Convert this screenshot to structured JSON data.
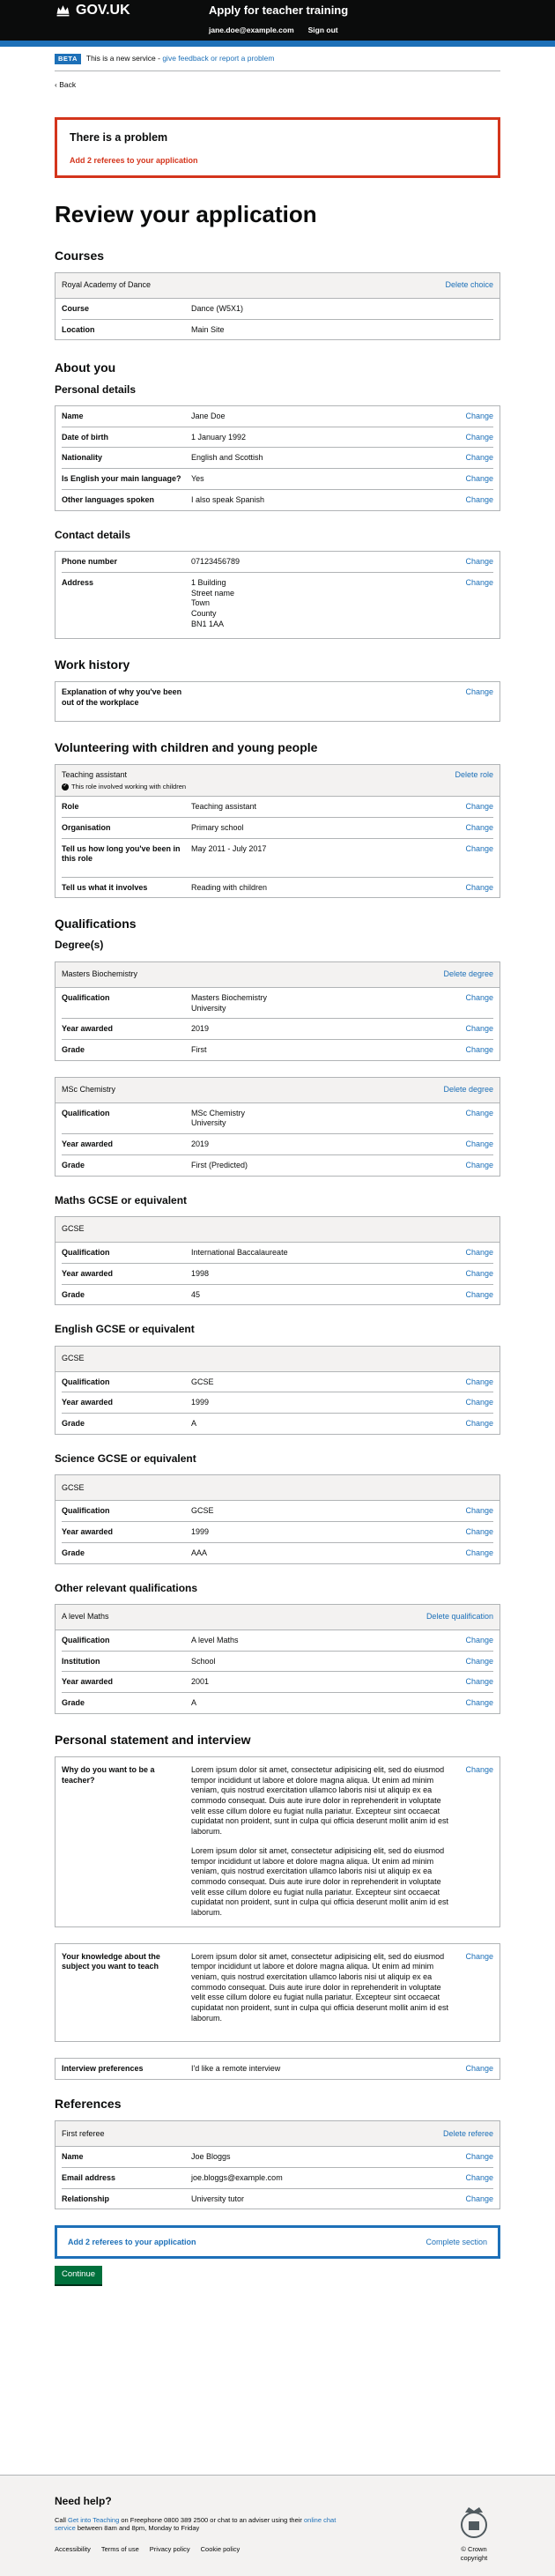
{
  "header": {
    "logo": "GOV.UK",
    "service": "Apply for teacher training",
    "email": "jane.doe@example.com",
    "signout": "Sign out"
  },
  "beta": {
    "tag": "BETA",
    "text": "This is a new service - ",
    "link": "give feedback or report a problem"
  },
  "back": "Back",
  "error": {
    "title": "There is a problem",
    "link": "Add 2 referees to your application"
  },
  "title": "Review your application",
  "courses": {
    "heading": "Courses",
    "card_title": "Royal Academy of Dance",
    "action": "Delete choice",
    "rows": [
      {
        "k": "Course",
        "v": "Dance (W5X1)"
      },
      {
        "k": "Location",
        "v": "Main Site"
      }
    ]
  },
  "about": "About you",
  "personal": {
    "heading": "Personal details",
    "rows": [
      {
        "k": "Name",
        "v": "Jane Doe"
      },
      {
        "k": "Date of birth",
        "v": "1 January 1992"
      },
      {
        "k": "Nationality",
        "v": "English and Scottish"
      },
      {
        "k": "Is English your main language?",
        "v": "Yes"
      },
      {
        "k": "Other languages spoken",
        "v": "I also speak Spanish"
      }
    ]
  },
  "change": "Change",
  "contact": {
    "heading": "Contact details",
    "phone_k": "Phone number",
    "phone_v": "07123456789",
    "addr_k": "Address",
    "addr": [
      "1 Building",
      "Street name",
      "Town",
      "County",
      "BN1 1AA"
    ]
  },
  "work": {
    "heading": "Work history",
    "k": "Explanation of why you've been out of the workplace"
  },
  "volunteer": {
    "heading": "Volunteering with children and young people",
    "card_title": "Teaching assistant",
    "note": "This role involved working with children",
    "action": "Delete role",
    "rows": [
      {
        "k": "Role",
        "v": "Teaching assistant"
      },
      {
        "k": "Organisation",
        "v": "Primary school"
      },
      {
        "k": "Tell us how long you've been in this role",
        "v": "May 2011 - July 2017"
      },
      {
        "k": "Tell us what it involves",
        "v": "Reading with children"
      }
    ]
  },
  "quals": "Qualifications",
  "degrees": {
    "heading": "Degree(s)",
    "action": "Delete degree",
    "items": [
      {
        "title": "Masters Biochemistry",
        "q1": "Masters Biochemistry",
        "q2": "University",
        "year": "2019",
        "grade": "First"
      },
      {
        "title": "MSc Chemistry",
        "q1": "MSc Chemistry",
        "q2": "University",
        "year": "2019",
        "grade": "First (Predicted)"
      }
    ]
  },
  "labels": {
    "qualification": "Qualification",
    "year": "Year awarded",
    "grade": "Grade",
    "institution": "Institution"
  },
  "gcses": [
    {
      "heading": "Maths GCSE or equivalent",
      "title": "GCSE",
      "q": "International Baccalaureate",
      "year": "1998",
      "grade": "45"
    },
    {
      "heading": "English GCSE or equivalent",
      "title": "GCSE",
      "q": "GCSE",
      "year": "1999",
      "grade": "A"
    },
    {
      "heading": "Science GCSE or equivalent",
      "title": "GCSE",
      "q": "GCSE",
      "year": "1999",
      "grade": "AAA"
    }
  ],
  "other": {
    "heading": "Other relevant qualifications",
    "title": "A level Maths",
    "action": "Delete qualification",
    "q": "A level Maths",
    "inst": "School",
    "year": "2001",
    "grade": "A"
  },
  "statement": {
    "heading": "Personal statement and interview",
    "why_k": "Why do you want to be a teacher?",
    "know_k": "Your knowledge about the subject you want to teach",
    "lorem": "Lorem ipsum dolor sit amet, consectetur adipisicing elit, sed do eiusmod tempor incididunt ut labore et dolore magna aliqua. Ut enim ad minim veniam, quis nostrud exercitation ullamco laboris nisi ut aliquip ex ea commodo consequat. Duis aute irure dolor in reprehenderit in voluptate velit esse cillum dolore eu fugiat nulla pariatur. Excepteur sint occaecat cupidatat non proident, sunt in culpa qui officia deserunt mollit anim id est laborum.",
    "int_k": "Interview preferences",
    "int_v": "I'd like a remote interview"
  },
  "references": {
    "heading": "References",
    "title": "First referee",
    "action": "Delete referee",
    "rows": [
      {
        "k": "Name",
        "v": "Joe Bloggs"
      },
      {
        "k": "Email address",
        "v": "joe.bloggs@example.com"
      },
      {
        "k": "Relationship",
        "v": "University tutor"
      }
    ]
  },
  "complete": {
    "label": "Add 2 referees to your application",
    "link": "Complete section"
  },
  "continue": "Continue",
  "footer": {
    "heading": "Need help?",
    "p1": "Call ",
    "l1": "Get into Teaching",
    "p2": " on Freephone 0800 389 2500 or chat to an adviser using their ",
    "l2": "online chat service",
    "p3": " between 8am and 8pm, Monday to Friday",
    "links": [
      "Accessibility",
      "Terms of use",
      "Privacy policy",
      "Cookie policy"
    ],
    "crown": "© Crown copyright"
  }
}
